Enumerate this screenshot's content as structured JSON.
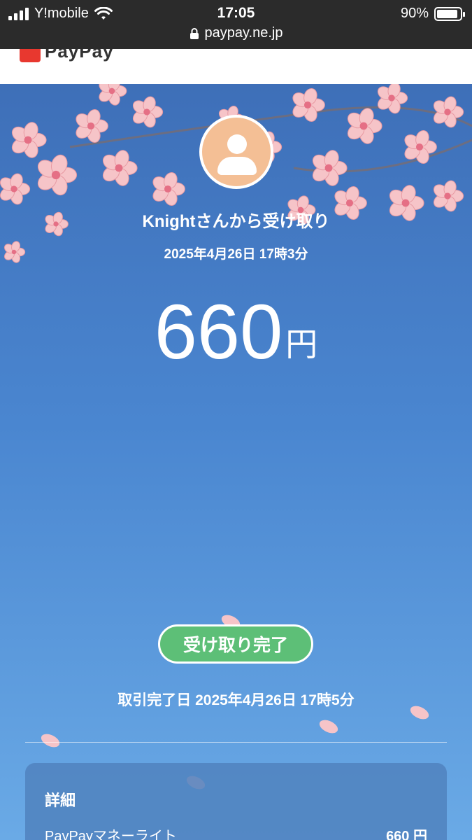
{
  "status_bar": {
    "carrier": "Y!mobile",
    "time": "17:05",
    "battery": "90%",
    "battery_level": 0.9,
    "url": "paypay.ne.jp"
  },
  "header": {
    "brand": "PayPay",
    "brand_color": "#e8382f"
  },
  "transfer": {
    "title": "Knightさんから受け取り",
    "sent_datetime": "2025年4月26日 17時3分",
    "amount": "660",
    "currency": "円",
    "status": "受け取り完了",
    "status_color": "#5dbf77",
    "completed_label": "取引完了日",
    "completed_datetime": "2025年4月26日 17時5分"
  },
  "details": {
    "title": "詳細",
    "rows": [
      {
        "label": "PayPayマネーライト",
        "value": "660 円"
      }
    ]
  },
  "icons": {
    "signal": "cellular-signal-icon",
    "wifi": "wifi-icon",
    "battery": "battery-icon",
    "lock": "lock-icon",
    "avatar": "user-avatar-icon"
  }
}
